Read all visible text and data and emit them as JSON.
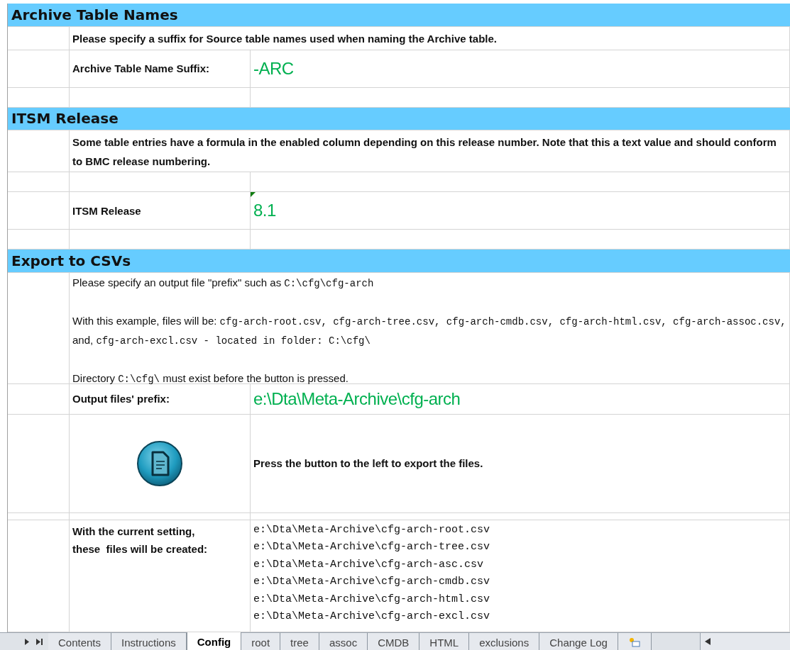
{
  "sections": [
    {
      "title": "Archive Table Names",
      "rows": [
        {
          "kind": "note",
          "text": "Please specify a suffix for Source table names used when naming the Archive table."
        },
        {
          "kind": "field",
          "label": "Archive Table Name Suffix:",
          "value": "-ARC",
          "indicator": false
        },
        {
          "kind": "blank"
        }
      ]
    },
    {
      "title": "ITSM Release",
      "rows": [
        {
          "kind": "note",
          "text": "Some table entries have a formula in the enabled column depending on this release number.  Note that this a text value and should conform to BMC release numbering."
        },
        {
          "kind": "blank"
        },
        {
          "kind": "field",
          "label": "ITSM Release",
          "value": "8.1",
          "indicator": true
        },
        {
          "kind": "blank"
        }
      ]
    },
    {
      "title": "Export to CSVs",
      "rows": [
        {
          "kind": "paragraphs",
          "paragraphs": [
            [
              {
                "text": "Please specify an output file \"prefix\" such as ",
                "mono": false
              },
              {
                "text": "C:\\cfg\\cfg-arch",
                "mono": true
              }
            ],
            [
              {
                "text": "With this example, files will be: ",
                "mono": false
              },
              {
                "text": "cfg-arch-root.csv,  cfg-arch-tree.csv,  cfg-arch-cmdb.csv, cfg-arch-html.csv, cfg-arch-assoc.csv,",
                "mono": true
              },
              {
                "text": " and, ",
                "mono": false
              },
              {
                "text": "cfg-arch-excl.csv - located in folder: C:\\cfg\\",
                "mono": true
              }
            ],
            [
              {
                "text": "Directory ",
                "mono": false
              },
              {
                "text": "C:\\cfg\\",
                "mono": true
              },
              {
                "text": " must exist before the button is pressed.",
                "mono": false
              }
            ]
          ]
        },
        {
          "kind": "field",
          "label": "Output files' prefix:",
          "value": "e:\\Dta\\Meta-Archive\\cfg-arch",
          "indicator": false
        },
        {
          "kind": "button",
          "text": "Press the button to the left to export the files."
        },
        {
          "kind": "spacer"
        },
        {
          "kind": "list",
          "label": "With the current setting,\nthese  files will be created:",
          "items": [
            "e:\\Dta\\Meta-Archive\\cfg-arch-root.csv",
            "e:\\Dta\\Meta-Archive\\cfg-arch-tree.csv",
            "e:\\Dta\\Meta-Archive\\cfg-arch-asc.csv",
            "e:\\Dta\\Meta-Archive\\cfg-arch-cmdb.csv",
            "e:\\Dta\\Meta-Archive\\cfg-arch-html.csv",
            "e:\\Dta\\Meta-Archive\\cfg-arch-excl.csv"
          ]
        }
      ]
    }
  ],
  "sheet_tabs": [
    {
      "label": "Contents",
      "selected": false
    },
    {
      "label": "Instructions",
      "selected": false
    },
    {
      "label": "Config",
      "selected": true
    },
    {
      "label": "root",
      "selected": false
    },
    {
      "label": "tree",
      "selected": false
    },
    {
      "label": "assoc",
      "selected": false
    },
    {
      "label": "CMDB",
      "selected": false
    },
    {
      "label": "HTML",
      "selected": false
    },
    {
      "label": "exclusions",
      "selected": false
    },
    {
      "label": "Change Log",
      "selected": false
    }
  ]
}
